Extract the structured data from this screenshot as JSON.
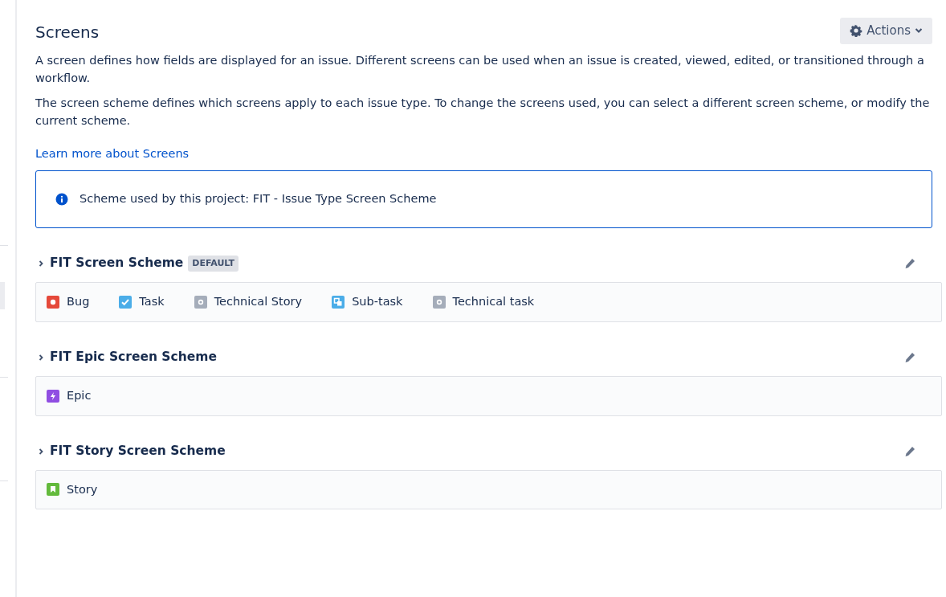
{
  "header": {
    "title": "Screens",
    "actions_button": "Actions"
  },
  "description": [
    "A screen defines how fields are displayed for an issue. Different screens can be used when an issue is created, viewed, edited, or transitioned through a workflow.",
    "The screen scheme defines which screens apply to each issue type. To change the screens used, you can select a different screen scheme, or modify the current scheme."
  ],
  "learn_more_link": "Learn more about Screens",
  "info_message": "Scheme used by this project: FIT - Issue Type Screen Scheme",
  "schemes": [
    {
      "name": "FIT Screen Scheme",
      "badge": "DEFAULT",
      "expanded": false,
      "issue_types": [
        {
          "kind": "bug",
          "label": "Bug"
        },
        {
          "kind": "task",
          "label": "Task"
        },
        {
          "kind": "technical",
          "label": "Technical Story"
        },
        {
          "kind": "subtask",
          "label": "Sub-task"
        },
        {
          "kind": "technical",
          "label": "Technical task"
        }
      ]
    },
    {
      "name": "FIT Epic Screen Scheme",
      "expanded": false,
      "issue_types": [
        {
          "kind": "epic",
          "label": "Epic"
        }
      ]
    },
    {
      "name": "FIT Story Screen Scheme",
      "expanded": false,
      "issue_types": [
        {
          "kind": "story",
          "label": "Story"
        }
      ]
    }
  ]
}
